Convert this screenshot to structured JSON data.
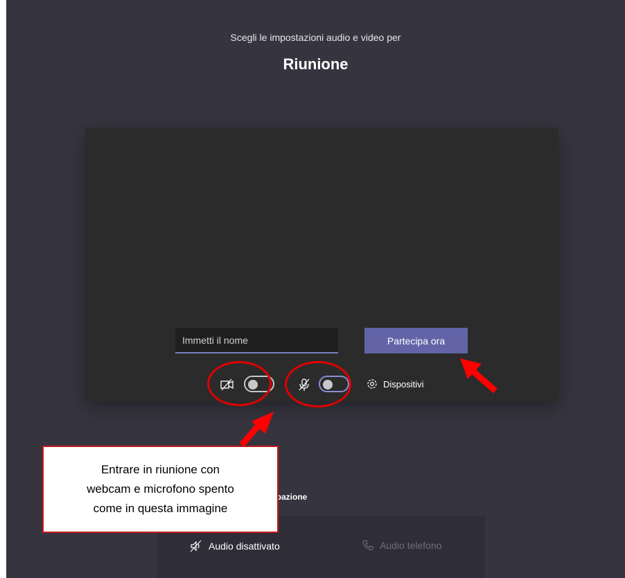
{
  "header": {
    "subtitle": "Scegli le impostazioni audio e video per",
    "title": "Riunione"
  },
  "preview": {
    "name_input_placeholder": "Immetti il nome",
    "join_button_label": "Partecipa ora",
    "video_toggle_state": "off",
    "mic_toggle_state": "off",
    "devices_label": "Dispositivi"
  },
  "join_options": {
    "title_partial": "opzioni di partecipazione",
    "audio_off_label": "Audio disattivato",
    "phone_audio_label": "Audio telefono"
  },
  "annotation": {
    "lines": [
      "Entrare in riunione con",
      "webcam e microfono spento",
      "come in questa immagine"
    ]
  },
  "colors": {
    "background": "#36353f",
    "preview_background": "#2b2b2b",
    "join_button": "#6264a7",
    "highlight": "#e00000",
    "toggle_on_border": "#8b8fd6"
  }
}
